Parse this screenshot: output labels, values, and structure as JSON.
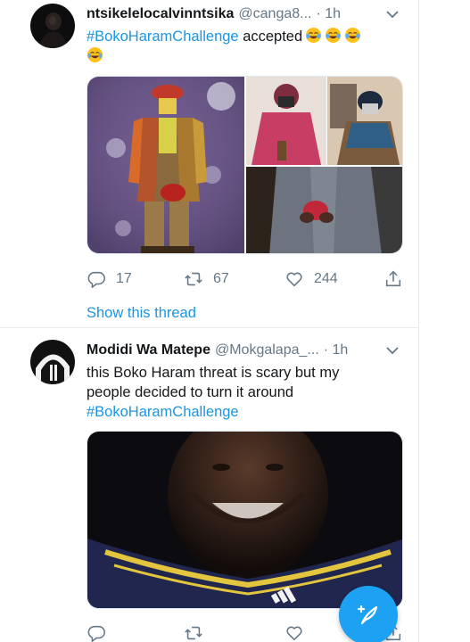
{
  "tweets": [
    {
      "name": "ntsikelelocalvinntsika",
      "handle": "@canga8...",
      "time": "· 1h",
      "hashtag": "#BokoHaramChallenge",
      "text_after_hashtag": " accepted",
      "emojis": [
        "face-with-tears-of-joy",
        "face-with-tears-of-joy",
        "face-with-tears-of-joy",
        "face-with-tears-of-joy"
      ],
      "actions": {
        "replies": "17",
        "retweets": "67",
        "likes": "244"
      },
      "show_thread": "Show this thread"
    },
    {
      "name": "Modidi Wa Matepe",
      "handle": "@Mokgalapa_...",
      "time": "· 1h",
      "line1": "this Boko Haram threat is scary but my",
      "line2": "people decided to turn it around",
      "hashtag": "#BokoHaramChallenge"
    }
  ],
  "icons": {
    "caret": "chevron-down-icon",
    "reply": "reply-icon",
    "retweet": "retweet-icon",
    "like": "heart-icon",
    "share": "share-icon",
    "compose": "compose-tweet-icon"
  },
  "colors": {
    "link": "#1b95e0",
    "secondary_text": "#657786",
    "fab": "#1da1f2"
  }
}
